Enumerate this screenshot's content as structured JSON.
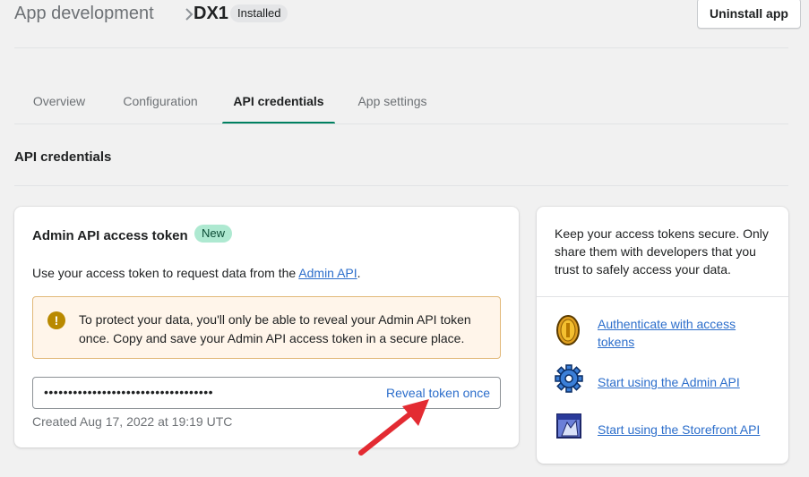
{
  "header": {
    "breadcrumb_parent": "App development",
    "app_name": "DX1",
    "status_badge": "Installed",
    "uninstall_label": "Uninstall app"
  },
  "tabs": [
    {
      "label": "Overview",
      "active": false
    },
    {
      "label": "Configuration",
      "active": false
    },
    {
      "label": "API credentials",
      "active": true
    },
    {
      "label": "App settings",
      "active": false
    }
  ],
  "section": {
    "title": "API credentials"
  },
  "admin_token_card": {
    "title": "Admin API access token",
    "new_badge": "New",
    "description_prefix": "Use your access token to request data from the ",
    "description_link": "Admin API",
    "description_suffix": ".",
    "banner_text": "To protect your data, you'll only be able to reveal your Admin API token once. Copy and save your Admin API access token in a secure place.",
    "token_masked": "•••••••••••••••••••••••••••••••••••",
    "reveal_label": "Reveal token once",
    "created_text": "Created Aug 17, 2022 at 19:19 UTC"
  },
  "side_card": {
    "tip_text": "Keep your access tokens secure. Only share them with developers that you trust to safely access your data.",
    "resources": [
      {
        "label": "Authenticate with access tokens",
        "icon": "coin-icon"
      },
      {
        "label": "Start using the Admin API",
        "icon": "gear-icon"
      },
      {
        "label": "Start using the Storefront API",
        "icon": "storefront-icon"
      }
    ]
  },
  "colors": {
    "accent": "#008060",
    "link": "#2c6ecb",
    "banner_bg": "#fff5ea",
    "new_badge_bg": "#aee9d1",
    "annotation_arrow": "#e32b32"
  }
}
